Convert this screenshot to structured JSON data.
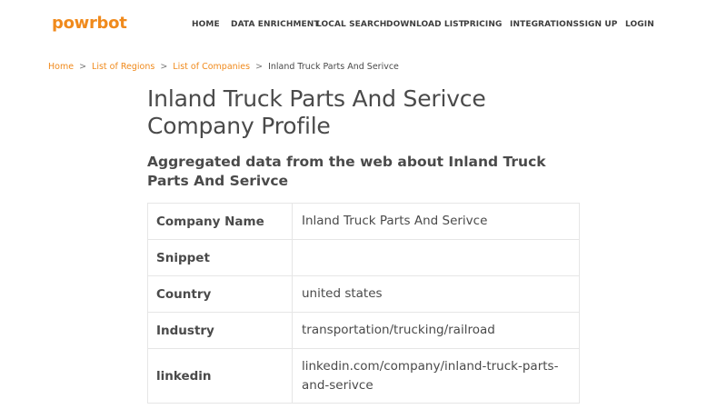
{
  "brand": {
    "logo": "powrbot",
    "accent": "#f08a1c"
  },
  "nav": [
    {
      "label": "HOME"
    },
    {
      "label": "DATA ENRICHMENT"
    },
    {
      "label": "LOCAL SEARCH"
    },
    {
      "label": "DOWNLOAD LIST"
    },
    {
      "label": "PRICING"
    },
    {
      "label": "INTEGRATIONS"
    },
    {
      "label": "SIGN UP"
    },
    {
      "label": "LOGIN"
    }
  ],
  "breadcrumb": {
    "home": "Home",
    "regions": "List of Regions",
    "companies": "List of Companies",
    "current": "Inland Truck Parts And Serivce",
    "separator": ">"
  },
  "page": {
    "title": "Inland Truck Parts And Serivce Company Profile",
    "subtitle": "Aggregated data from the web about Inland Truck Parts And Serivce"
  },
  "profile": [
    {
      "key": "Company Name",
      "value": "Inland Truck Parts And Serivce"
    },
    {
      "key": "Snippet",
      "value": ""
    },
    {
      "key": "Country",
      "value": "united states"
    },
    {
      "key": "Industry",
      "value": "transportation/trucking/railroad"
    },
    {
      "key": "linkedin",
      "value": "linkedin.com/company/inland-truck-parts-and-serivce"
    }
  ]
}
